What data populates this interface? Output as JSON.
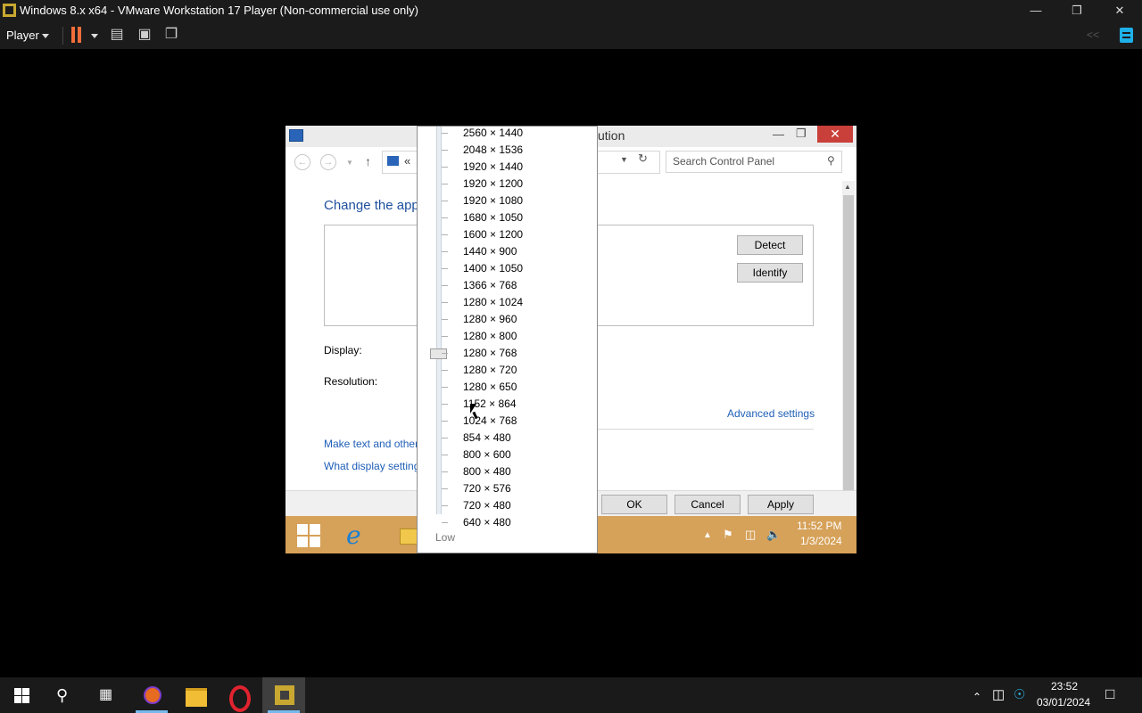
{
  "vmware": {
    "window_title": "Windows 8.x x64 - VMware Workstation 17 Player (Non-commercial use only)",
    "menu_label": "Player"
  },
  "guest_window": {
    "title_fragment": "ution",
    "breadcrumb": "«",
    "search_placeholder": "Search Control Panel",
    "heading": "Change the app",
    "detect_label": "Detect",
    "identify_label": "Identify",
    "display_label": "Display:",
    "resolution_label": "Resolution:",
    "advanced_link": "Advanced settings",
    "link_text_size": "Make text and other",
    "link_display_settings": "What display setting",
    "ok_label": "OK",
    "cancel_label": "Cancel",
    "apply_label": "Apply"
  },
  "resolution_dropdown": {
    "options": [
      "2560 × 1440",
      "2048 × 1536",
      "1920 × 1440",
      "1920 × 1200",
      "1920 × 1080",
      "1680 × 1050",
      "1600 × 1200",
      "1440 × 900",
      "1400 × 1050",
      "1366 × 768",
      "1280 × 1024",
      "1280 × 960",
      "1280 × 800",
      "1280 × 768",
      "1280 × 720",
      "1280 × 650",
      "1152 × 864",
      "1024 × 768",
      "854 × 480",
      "800 × 600",
      "800 × 480",
      "720 × 576",
      "720 × 480",
      "640 × 480"
    ],
    "selected": "1280 × 768",
    "low_label": "Low"
  },
  "guest_taskbar": {
    "time": "11:52 PM",
    "date": "1/3/2024"
  },
  "host_taskbar": {
    "time": "23:52",
    "date": "03/01/2024"
  },
  "icons": {
    "vmware_logo": "vmware-logo-icon",
    "pause": "pause-icon",
    "send_ctrl_alt_del": "send-keys-icon",
    "fullscreen": "fullscreen-icon",
    "unity": "unity-icon",
    "notes": "notes-icon"
  },
  "colors": {
    "pause_accent": "#f36d3a",
    "guest_taskbar": "#d6a159",
    "link_blue": "#1f5fb8",
    "close_red": "#c9403a"
  }
}
